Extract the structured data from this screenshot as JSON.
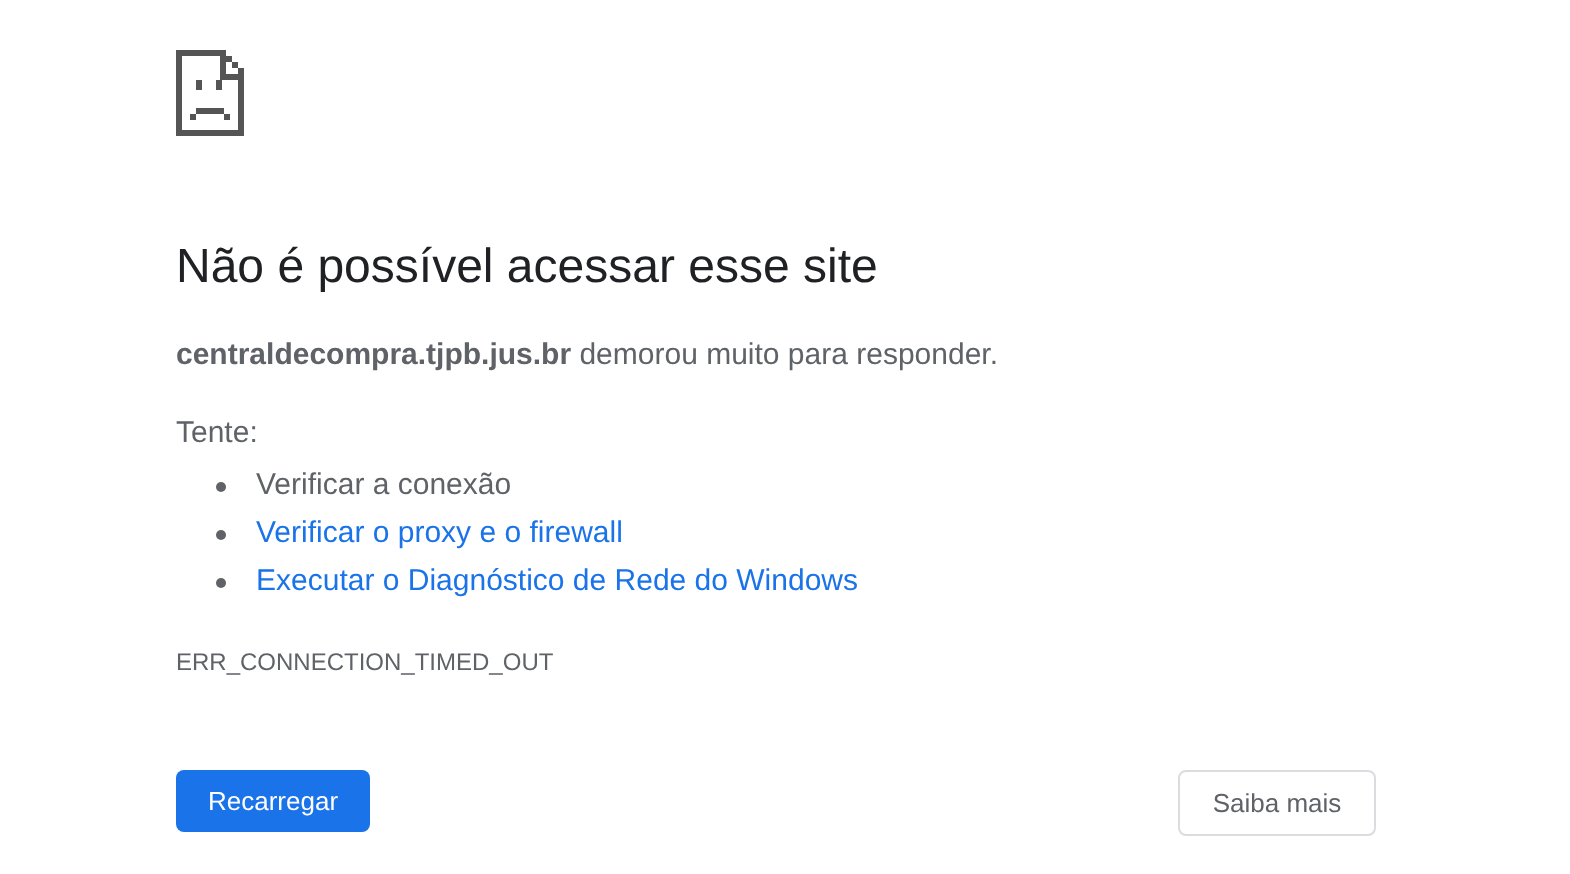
{
  "heading": "Não é possível acessar esse site",
  "summary": "**centraldecompra.tjpb.jus.br** demorou muito para responder.",
  "suggestions_label": "Tente:",
  "suggestions": [
    {
      "kind": "text",
      "label": "Verificar a conexão"
    },
    {
      "kind": "link",
      "label": "Verificar o proxy e o firewall"
    },
    {
      "kind": "link",
      "label": "Executar o Diagnóstico de Rede do Windows"
    }
  ],
  "error_code": "ERR_CONNECTION_TIMED_OUT",
  "buttons": [
    {
      "kind": "primary",
      "label": "Recarregar"
    },
    {
      "kind": "secondary",
      "label": "Saiba mais"
    }
  ]
}
